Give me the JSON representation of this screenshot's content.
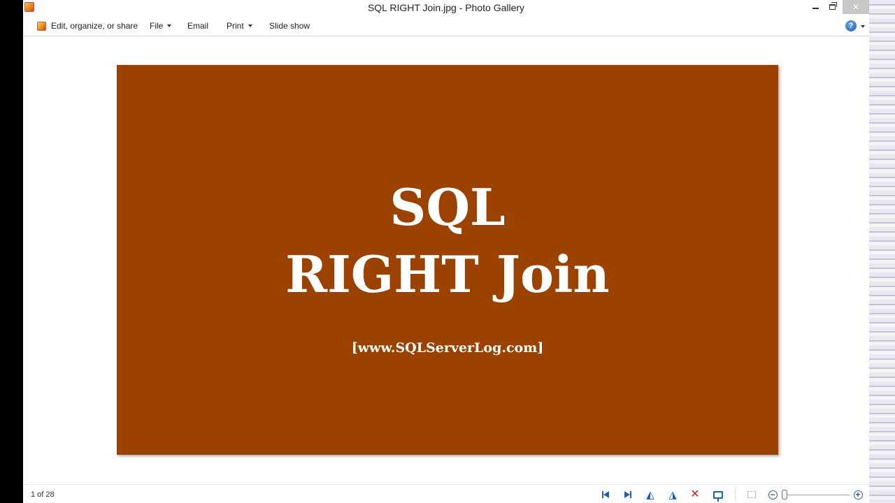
{
  "window": {
    "title": "SQL RIGHT Join.jpg - Photo Gallery"
  },
  "commandbar": {
    "edit_label": "Edit, organize, or share",
    "file_label": "File",
    "email_label": "Email",
    "print_label": "Print",
    "slideshow_label": "Slide show",
    "help_label": "?"
  },
  "photo": {
    "line1": "SQL",
    "line2": "RIGHT Join",
    "url": "[www.SQLServerLog.com]",
    "background_color": "#9b4200"
  },
  "statusbar": {
    "count": "1 of 28",
    "zoom_out_label": "−",
    "zoom_in_label": "+",
    "icons": [
      "previous-icon",
      "next-icon",
      "rotate-left-icon",
      "rotate-right-icon",
      "delete-icon",
      "slideshow-icon",
      "fit-to-window-icon",
      "zoom-out-icon",
      "zoom-slider",
      "zoom-in-icon"
    ]
  },
  "colors": {
    "accent": "#1f5fb5",
    "delete": "#d02020"
  }
}
